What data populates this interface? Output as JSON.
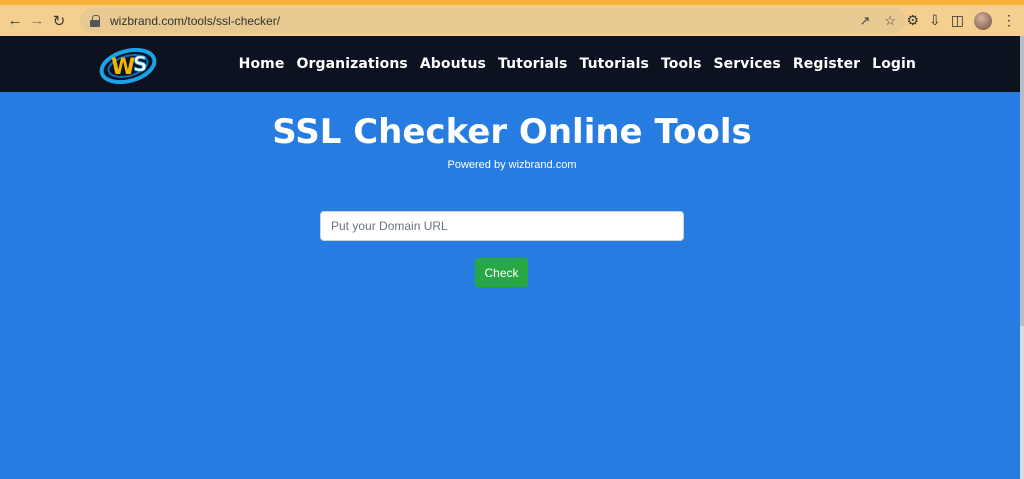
{
  "browser": {
    "url": "wizbrand.com/tools/ssl-checker/",
    "icons": [
      "back-arrow-icon",
      "forward-arrow-icon",
      "reload-icon",
      "lock-icon",
      "share-icon",
      "star-icon",
      "extensions-icon",
      "download-icon",
      "sidepanel-icon",
      "profile-avatar",
      "kebab-menu-icon"
    ]
  },
  "header": {
    "logo_text": "WS",
    "nav": [
      "Home",
      "Organizations",
      "Aboutus",
      "Tutorials",
      "Tutorials",
      "Tools",
      "Services",
      "Register",
      "Login"
    ]
  },
  "main": {
    "title": "SSL Checker Online Tools",
    "subtitle": "Powered by wizbrand.com",
    "input_placeholder": "Put your Domain URL",
    "check_label": "Check"
  },
  "colors": {
    "accent_bg": "#267ce1",
    "header_bg": "#0c1220",
    "button_green": "#28a745",
    "chrome_bar": "#f5cf8f"
  }
}
